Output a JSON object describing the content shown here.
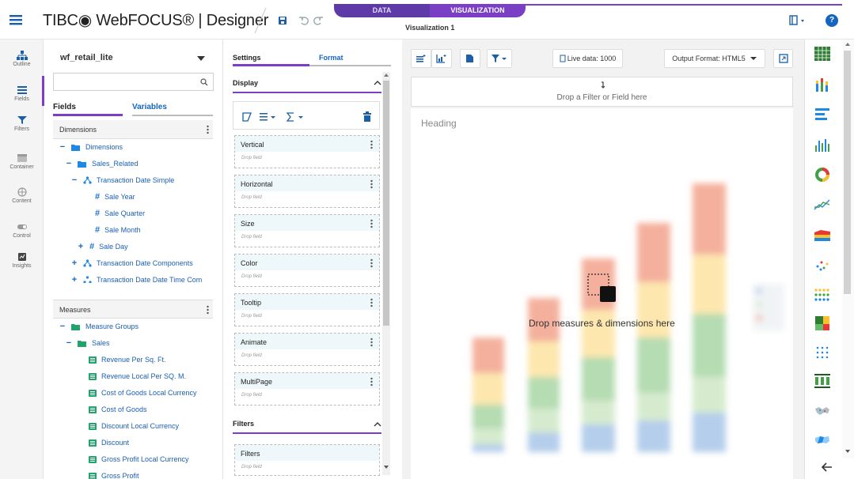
{
  "app": {
    "brand": "TIBC◉ WebFOCUS® | Designer",
    "tab_data": "DATA",
    "tab_visualization": "VISUALIZATION",
    "title": "Visualization 1",
    "help": "?"
  },
  "rail": [
    {
      "label": "Outline",
      "icon": "outline-icon"
    },
    {
      "label": "Fields",
      "icon": "list-icon"
    },
    {
      "label": "Filters",
      "icon": "filter-icon"
    },
    {
      "label": "Container",
      "icon": "container-icon"
    },
    {
      "label": "Content",
      "icon": "globe-icon"
    },
    {
      "label": "Control",
      "icon": "toggle-icon"
    },
    {
      "label": "Insights",
      "icon": "insights-icon"
    }
  ],
  "fields": {
    "datasource": "wf_retail_lite",
    "search_placeholder": "",
    "tab_fields": "Fields",
    "tab_variables": "Variables",
    "dimensions_header": "Dimensions",
    "dimensions": [
      {
        "label": "Dimensions",
        "toggle": "−"
      },
      {
        "label": "Sales_Related",
        "toggle": "−"
      },
      {
        "label": "Transaction Date Simple",
        "toggle": "−"
      },
      {
        "label": "Sale Year",
        "toggle": ""
      },
      {
        "label": "Sale Quarter",
        "toggle": ""
      },
      {
        "label": "Sale Month",
        "toggle": ""
      },
      {
        "label": "Sale Day",
        "toggle": "+"
      },
      {
        "label": "Transaction Date Components",
        "toggle": "+"
      },
      {
        "label": "Transaction Date Date Time Com",
        "toggle": "+"
      }
    ],
    "measures_header": "Measures",
    "measures": [
      {
        "label": "Measure Groups",
        "toggle": "−"
      },
      {
        "label": "Sales",
        "toggle": "−"
      },
      {
        "label": "Revenue Per Sq. Ft."
      },
      {
        "label": "Revenue Local Per SQ. M."
      },
      {
        "label": "Cost of Goods Local Currency"
      },
      {
        "label": "Cost of Goods"
      },
      {
        "label": "Discount Local Currency"
      },
      {
        "label": "Discount"
      },
      {
        "label": "Gross Profit Local Currency"
      },
      {
        "label": "Gross Profit"
      }
    ]
  },
  "settings": {
    "tab_settings": "Settings",
    "tab_format": "Format",
    "display_header": "Display",
    "buckets": [
      {
        "label": "Vertical",
        "drop": "Drop field"
      },
      {
        "label": "Horizontal",
        "drop": "Drop field"
      },
      {
        "label": "Size",
        "drop": "Drop field"
      },
      {
        "label": "Color",
        "drop": "Drop field"
      },
      {
        "label": "Tooltip",
        "drop": "Drop field"
      },
      {
        "label": "Animate",
        "drop": "Drop field"
      },
      {
        "label": "MultiPage",
        "drop": "Drop field"
      }
    ],
    "filters_header": "Filters",
    "filters_bucket": {
      "label": "Filters",
      "drop": "Drop field"
    }
  },
  "canvas": {
    "live_data": "Live data: 1000",
    "output_format": "Output Format: HTML5",
    "filter_drop": "Drop a Filter or Field here",
    "heading": "Heading",
    "drop_hint": "Drop measures & dimensions here"
  },
  "colors": {
    "accent": "#7a3fc4",
    "data_tab": "#5d3aa8",
    "link": "#1565c0",
    "measure_icon": "#22a36b"
  },
  "picker": [
    "table-icon",
    "stacked-bar-icon",
    "horizontal-bar-icon",
    "column-icon",
    "donut-icon",
    "line-icon",
    "area-icon",
    "scatter-icon",
    "dot-matrix-icon",
    "treemap-icon",
    "bubble-icon",
    "grid-bar-icon",
    "map-icon",
    "choropleth-icon"
  ]
}
